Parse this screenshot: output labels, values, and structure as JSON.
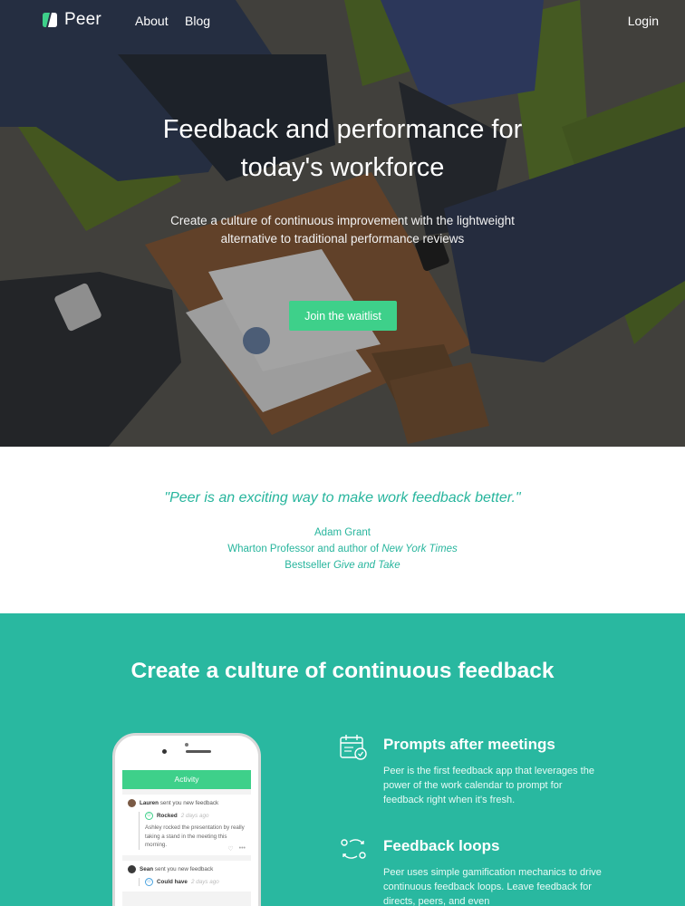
{
  "nav": {
    "logo_text": "Peer",
    "links": [
      "About",
      "Blog"
    ],
    "login": "Login"
  },
  "hero": {
    "title_line1": "Feedback and performance for",
    "title_line2": "today's workforce",
    "subtitle_line1": "Create a culture of continuous improvement with the lightweight",
    "subtitle_line2": "alternative to traditional performance reviews",
    "cta": "Join the waitlist"
  },
  "quote": {
    "text": "\"Peer is an exciting way to make work feedback better.\"",
    "author_name": "Adam Grant",
    "author_role_prefix": "Wharton Professor and author of ",
    "author_role_italic": "New York Times",
    "author_role2_prefix": "Bestseller ",
    "author_role2_italic": "Give and Take"
  },
  "features": {
    "title": "Create a culture of continuous feedback",
    "items": [
      {
        "icon": "calendar-icon",
        "title": "Prompts after meetings",
        "text": "Peer is the first feedback app that leverages the power of the work calendar to prompt for feedback right when it's fresh."
      },
      {
        "icon": "loop-icon",
        "title": "Feedback loops",
        "text": "Peer uses simple gamification mechanics to drive continuous feedback loops. Leave feedback for directs, peers, and even"
      }
    ]
  },
  "phone": {
    "header": "Activity",
    "cards": [
      {
        "name": "Lauren",
        "action": " sent you new feedback",
        "tag": "Rocked",
        "time": "2 days ago",
        "text": "Ashley rocked the presentation by really taking a stand in the meeting this morning."
      },
      {
        "name": "Sean",
        "action": " sent you new feedback",
        "tag": "Could have",
        "time": "2 days ago",
        "text": ""
      }
    ]
  },
  "colors": {
    "accent": "#3ed08a",
    "teal": "#29b8a0",
    "quote_text": "#27b59d"
  }
}
